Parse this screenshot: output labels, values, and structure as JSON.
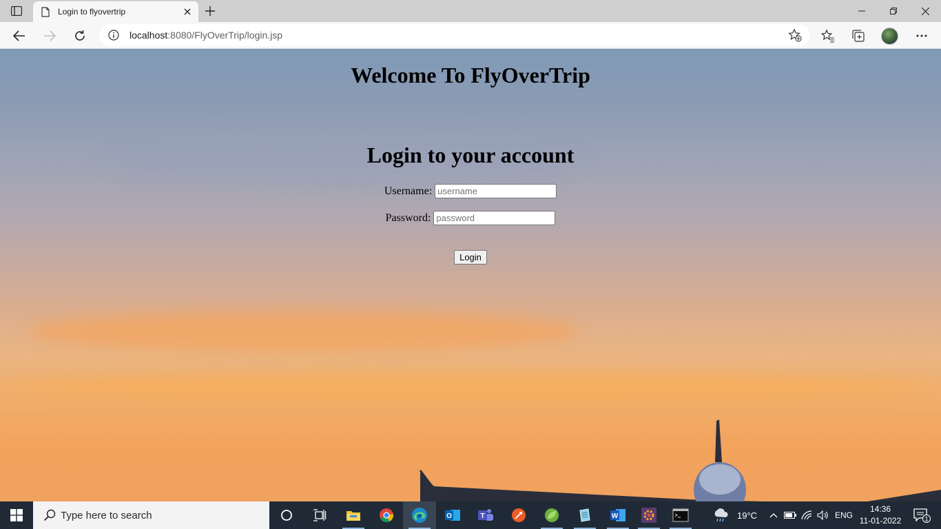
{
  "browser": {
    "tab_title": "Login to flyovertrip",
    "url_host": "localhost",
    "url_rest": ":8080/FlyOverTrip/login.jsp"
  },
  "page": {
    "welcome_heading": "Welcome To FlyOverTrip",
    "login_heading": "Login to your account",
    "username_label": "Username:",
    "username_placeholder": "username",
    "username_value": "",
    "password_label": "Password:",
    "password_placeholder": "password",
    "password_value": "",
    "login_button": "Login"
  },
  "taskbar": {
    "search_placeholder": "Type here to search",
    "weather": "19°C",
    "language": "ENG",
    "time": "14:36",
    "date": "11-01-2022",
    "notification_count": "1"
  },
  "icons": {
    "sidebar": "sidebar-toggle-icon",
    "tab_page": "page-icon",
    "tab_close": "close-icon",
    "new_tab": "plus-icon",
    "back": "arrow-left-icon",
    "forward": "arrow-right-icon",
    "refresh": "refresh-icon",
    "site_info": "info-icon",
    "add_favorite": "star-plus-icon",
    "favorites": "star-list-icon",
    "collections": "collections-icon",
    "menu": "ellipsis-icon"
  },
  "colors": {
    "taskbar_bg": "#1f2a36",
    "chrome_bg": "#f7f7f7",
    "titlebar_bg": "#cfcfcf"
  }
}
